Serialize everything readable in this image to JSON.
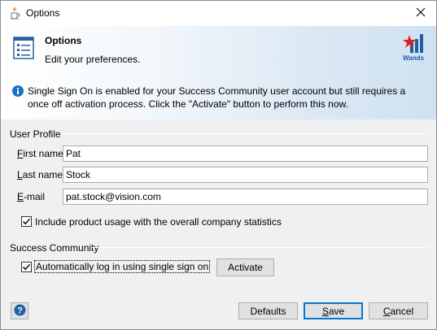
{
  "window": {
    "title": "Options",
    "close_icon": "close-icon",
    "app_icon": "java-cup-icon"
  },
  "header": {
    "title": "Options",
    "subtitle": "Edit your preferences.",
    "logo_text": "Wands",
    "info_text": "Single Sign On is enabled for your Success Community user account but still requires a once off activation process. Click the \"Activate\" button to perform this now."
  },
  "user_profile": {
    "section_label": "User Profile",
    "first_name": {
      "label_mnemonic": "F",
      "label_rest": "irst name",
      "value": "Pat"
    },
    "last_name": {
      "label_mnemonic": "L",
      "label_rest": "ast name",
      "value": "Stock"
    },
    "email": {
      "label_mnemonic": "E",
      "label_rest": "-mail",
      "value": "pat.stock@vision.com"
    },
    "include_usage": {
      "label": "Include product usage with the overall company statistics",
      "checked": true
    }
  },
  "success_community": {
    "section_label": "Success Community",
    "auto_login": {
      "label": "Automatically log in using single sign on",
      "checked": true
    },
    "activate_label": "Activate"
  },
  "footer": {
    "help_label": "?",
    "defaults_label": "Defaults",
    "save_mnemonic": "S",
    "save_rest": "ave",
    "cancel_mnemonic": "C",
    "cancel_rest": "ancel"
  },
  "colors": {
    "accent": "#0078d7",
    "info_blue": "#1e72c8",
    "logo_red": "#e02020",
    "logo_blue": "#1e5fa8"
  }
}
